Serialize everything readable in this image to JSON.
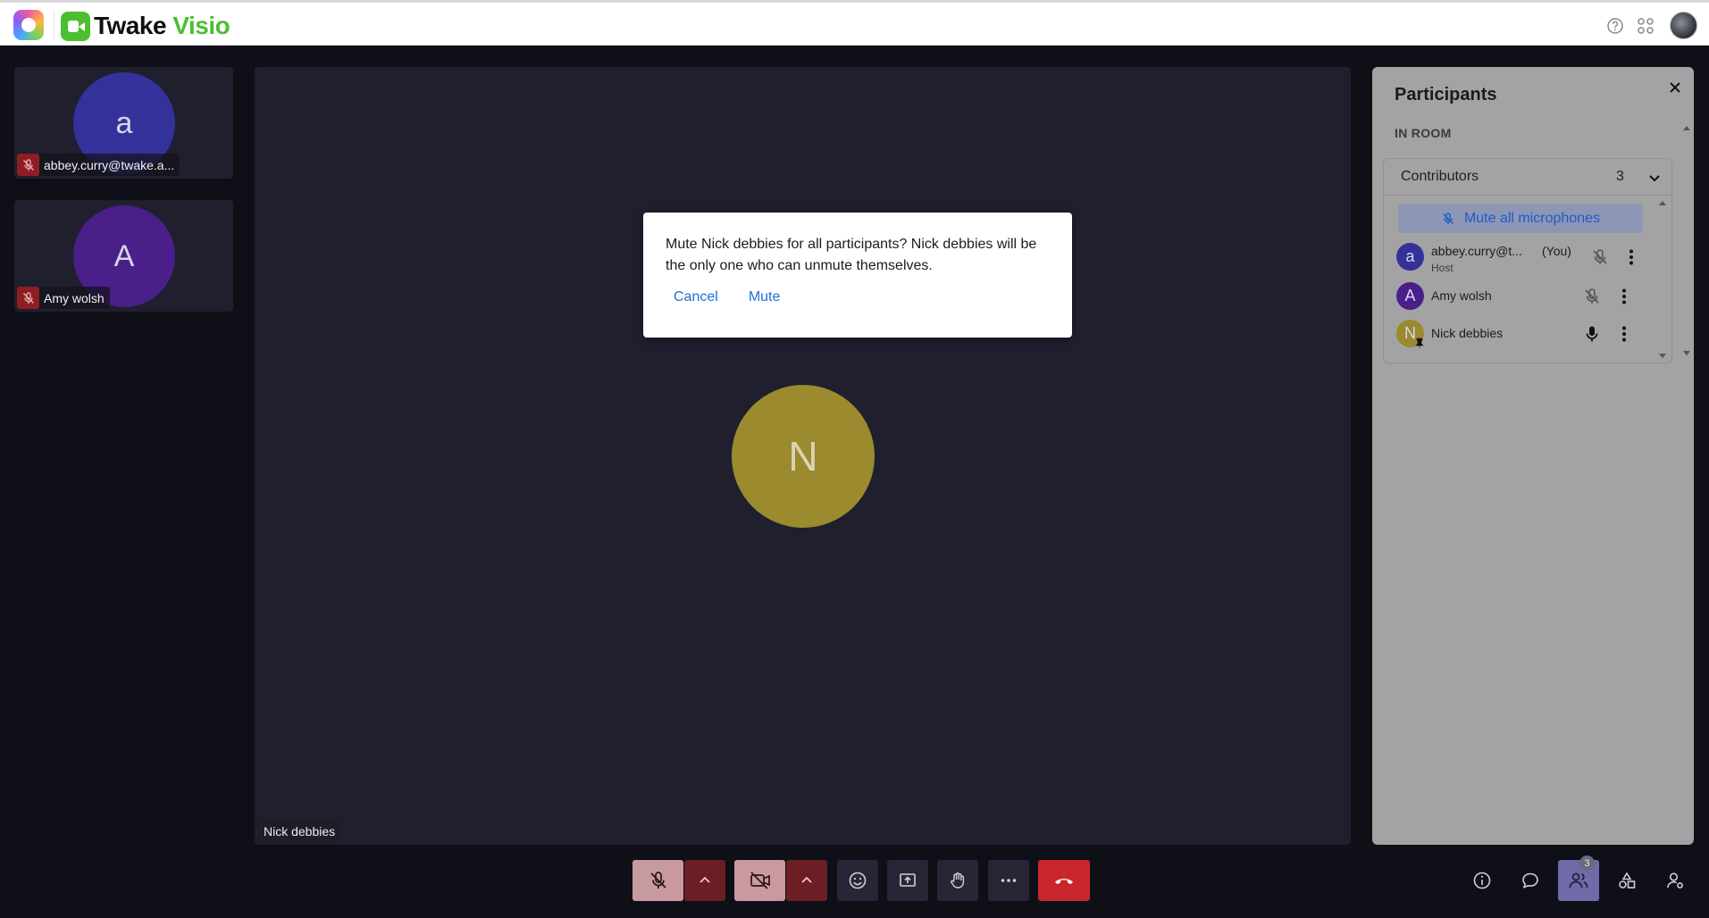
{
  "header": {
    "brand_part1": "Twake",
    "brand_part2": "Visio"
  },
  "thumbnails": [
    {
      "initial": "a",
      "name": "abbey.curry@twake.a...",
      "color": "#34319a"
    },
    {
      "initial": "A",
      "name": "Amy wolsh",
      "color": "#4a1f8a"
    }
  ],
  "stage": {
    "initial": "N",
    "name": "Nick debbies"
  },
  "dialog": {
    "message": "Mute Nick debbies for all participants? Nick debbies will be the only one who can unmute themselves.",
    "cancel_label": "Cancel",
    "mute_label": "Mute"
  },
  "panel": {
    "title": "Participants",
    "section": "IN ROOM",
    "contributors_label": "Contributors",
    "contributors_count": "3",
    "mute_all_label": "Mute all microphones",
    "participants": [
      {
        "initial": "a",
        "name": "abbey.curry@t...",
        "you": "(You)",
        "role": "Host",
        "color": "#34319a",
        "mic": "mic-off"
      },
      {
        "initial": "A",
        "name": "Amy wolsh",
        "you": "",
        "role": "",
        "color": "#4a1f8a",
        "mic": "mic-off"
      },
      {
        "initial": "N",
        "name": "Nick debbies",
        "you": "",
        "role": "",
        "color": "#9b8a2e",
        "mic": "mic-on"
      }
    ]
  },
  "controls": {
    "participants_badge": "3"
  }
}
